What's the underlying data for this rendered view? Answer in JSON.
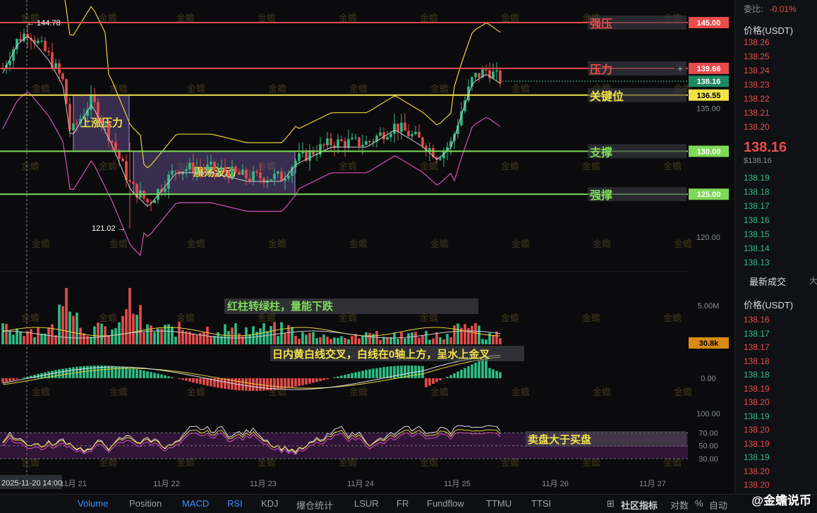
{
  "chart_data": {
    "type": "candlestick",
    "price_levels": [
      {
        "label": "强压",
        "value": 145.0,
        "color": "#e84b4b"
      },
      {
        "label": "压力",
        "value": 139.66,
        "color": "#e84b4b"
      },
      {
        "label": "关键位",
        "value": 136.55,
        "color": "#f2e14a"
      },
      {
        "label": "支撑",
        "value": 130.0,
        "color": "#7ed957"
      },
      {
        "label": "强撑",
        "value": 125.0,
        "color": "#7ed957"
      }
    ],
    "axis_ticks": [
      "135.00",
      "120.00"
    ],
    "volume_tick": "5.00M",
    "macd_tick": "0.00",
    "rsi_ticks": [
      "100.00",
      "70.00",
      "50.00",
      "30.00"
    ],
    "current_price": "138.16",
    "volume_value": "30.8k",
    "high_label": "144.78",
    "low_label": "121.02",
    "boxes": [
      {
        "label": "上涨压力"
      },
      {
        "label": "震荡波动"
      }
    ],
    "x_labels": [
      "2025-11-20 14:00",
      "11月 21",
      "11月 22",
      "11月 23",
      "11月 24",
      "11月 25",
      "11月 26",
      "11月 27"
    ],
    "annotations": {
      "volume": "红柱转绿柱，量能下跌",
      "macd": "日内黄白线交叉，白线在0轴上方，呈水上金叉",
      "rsi": "卖盘大于买盘"
    }
  },
  "right_panel": {
    "commission_label": "委比:",
    "commission_value": "-0.01%",
    "price_header": "价格(USDT)",
    "asks": [
      "138.26",
      "138.25",
      "138.24",
      "138.23",
      "138.22",
      "138.21",
      "138.20"
    ],
    "last_price": "138.16",
    "last_price_usd": "$138.16",
    "bids": [
      "138.19",
      "138.18",
      "138.17",
      "138.16",
      "138.15",
      "138.14",
      "138.13"
    ],
    "trades_tab": "最新成交",
    "trades_tab_extra": "大",
    "trades_header": "价格(USDT)",
    "trades": [
      "138.16",
      "138.17",
      "138.17",
      "138.18",
      "138.18",
      "138.19",
      "138.20",
      "138.19",
      "138.20",
      "138.19",
      "138.19",
      "138.20",
      "138.20"
    ]
  },
  "bottom_tabs": [
    "Volume",
    "Position",
    "MACD",
    "RSI",
    "KDJ",
    "爆仓统计",
    "LSUR",
    "FR",
    "Fundflow",
    "TTMU",
    "TTSI"
  ],
  "bottom_right": {
    "community": "社区指标",
    "log": "对数",
    "percent": "%",
    "auto": "自动"
  },
  "brand_watermark": "金蟾",
  "brand": "@金蟾说币",
  "colors": {
    "up": "#2ebd85",
    "down": "#e84b4b",
    "yellow": "#f2e14a",
    "green_line": "#7ed957"
  }
}
